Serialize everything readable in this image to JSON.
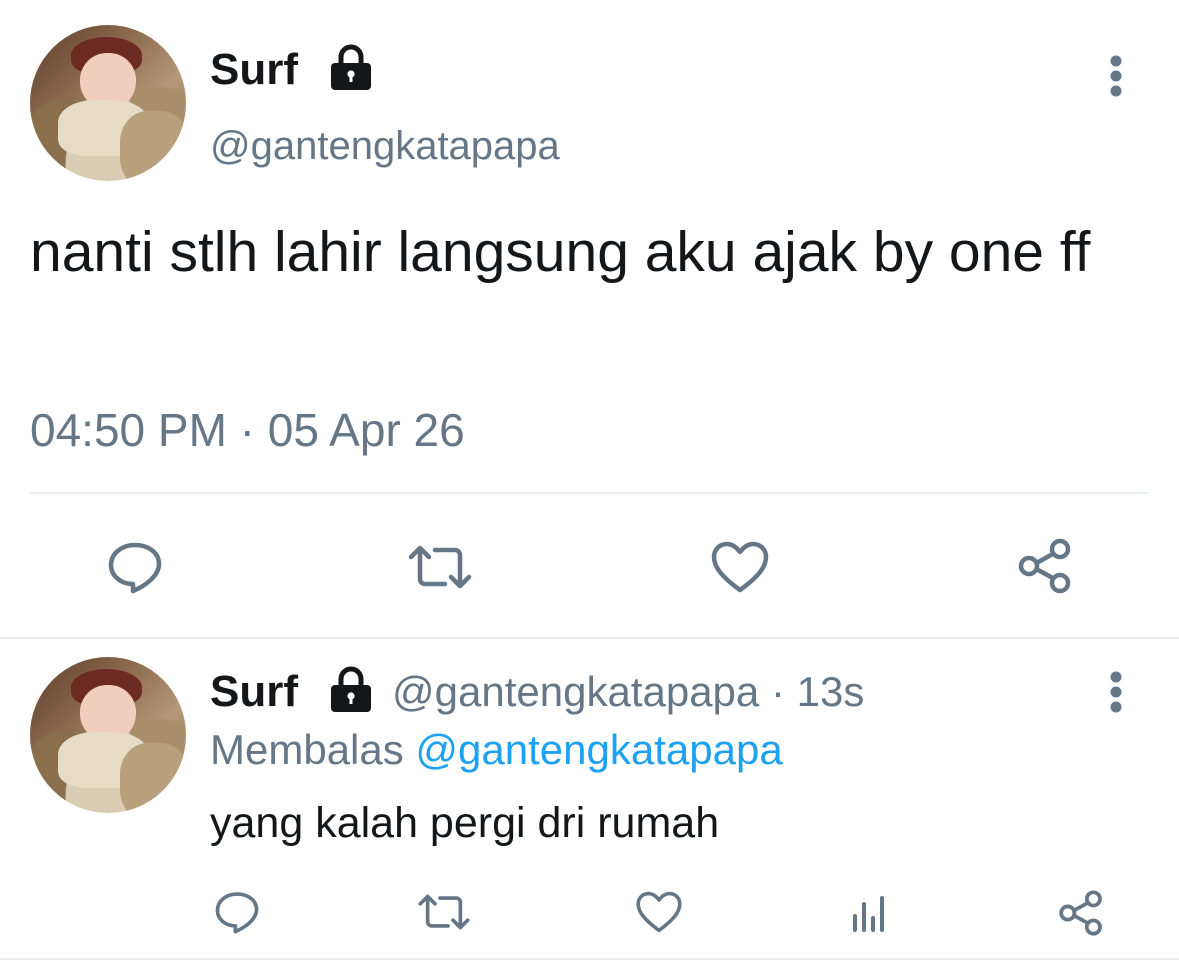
{
  "main_tweet": {
    "display_name": "Surf",
    "locked_icon": "lock-icon",
    "handle": "@gantengkatapapa",
    "menu_icon": "more-vertical-icon",
    "text": "nanti stlh lahir langsung aku ajak by one ff",
    "timestamp": "04:50 PM · 05 Apr 26",
    "actions": {
      "reply_icon": "reply-icon",
      "retweet_icon": "retweet-icon",
      "like_icon": "heart-icon",
      "share_icon": "share-icon"
    }
  },
  "reply_tweet": {
    "display_name": "Surf",
    "locked_icon": "lock-icon",
    "handle_time": "@gantengkatapapa · 13s",
    "replying_prefix": "Membalas",
    "replying_to": "@gantengkatapapa",
    "text": "yang kalah pergi dri rumah",
    "menu_icon": "more-vertical-icon",
    "actions": {
      "reply_icon": "reply-icon",
      "retweet_icon": "retweet-icon",
      "like_icon": "heart-icon",
      "analytics_icon": "analytics-icon",
      "share_icon": "share-icon"
    }
  },
  "colors": {
    "text": "#14171a",
    "muted": "#657786",
    "link": "#1da1f2",
    "divider": "#e6ecf0"
  }
}
